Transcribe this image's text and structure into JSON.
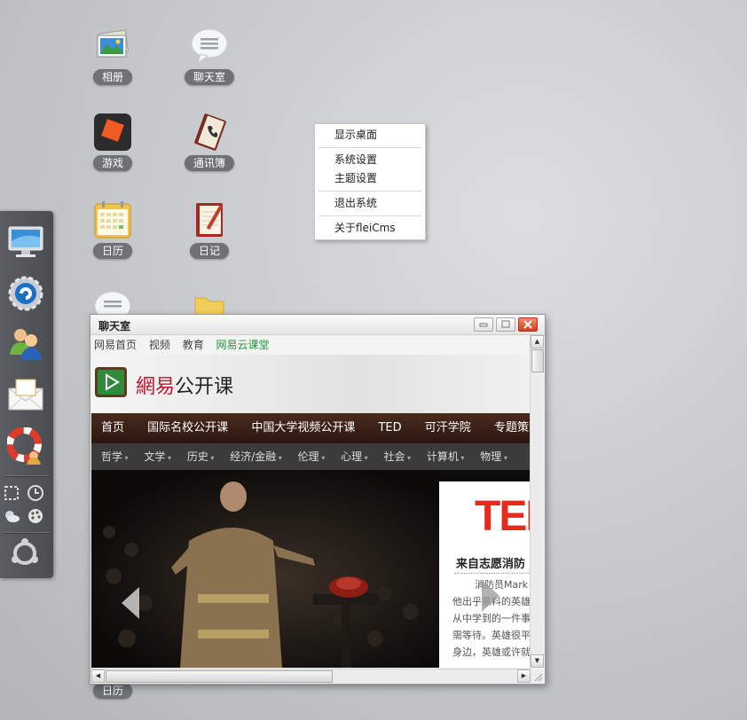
{
  "desktop": {
    "icons": [
      {
        "label": "相册"
      },
      {
        "label": "聊天室"
      },
      {
        "label": "游戏"
      },
      {
        "label": "通讯簿"
      },
      {
        "label": "日历"
      },
      {
        "label": "日记"
      },
      {
        "label": "日历"
      }
    ]
  },
  "context_menu": {
    "items": [
      "显示桌面",
      "系统设置",
      "主题设置",
      "退出系统",
      "关于fleiCms"
    ]
  },
  "window": {
    "title": "聊天室",
    "browser": {
      "top_links": [
        "网易首页",
        "视频",
        "教育",
        "网易云课堂"
      ],
      "logo_text_red": "網易",
      "logo_text_black": "公开课",
      "main_nav": [
        "首页",
        "国际名校公开课",
        "中国大学视频公开课",
        "TED",
        "可汗学院",
        "专题策划"
      ],
      "sub_nav": [
        "哲学",
        "文学",
        "历史",
        "经济/金融",
        "伦理",
        "心理",
        "社会",
        "计算机",
        "物理"
      ],
      "ted_card": {
        "logo": "TED",
        "headline": "来自志愿消防",
        "lines": [
          "消防员Mark",
          "他出乎意料的英雄",
          "从中学到的一件事",
          "需等待。英雄很平",
          "身边，英雄或许就"
        ]
      }
    }
  },
  "colors": {
    "accent_green": "#1e9a3c",
    "logo_red": "#c8102e",
    "ted_red": "#e62b1e"
  }
}
